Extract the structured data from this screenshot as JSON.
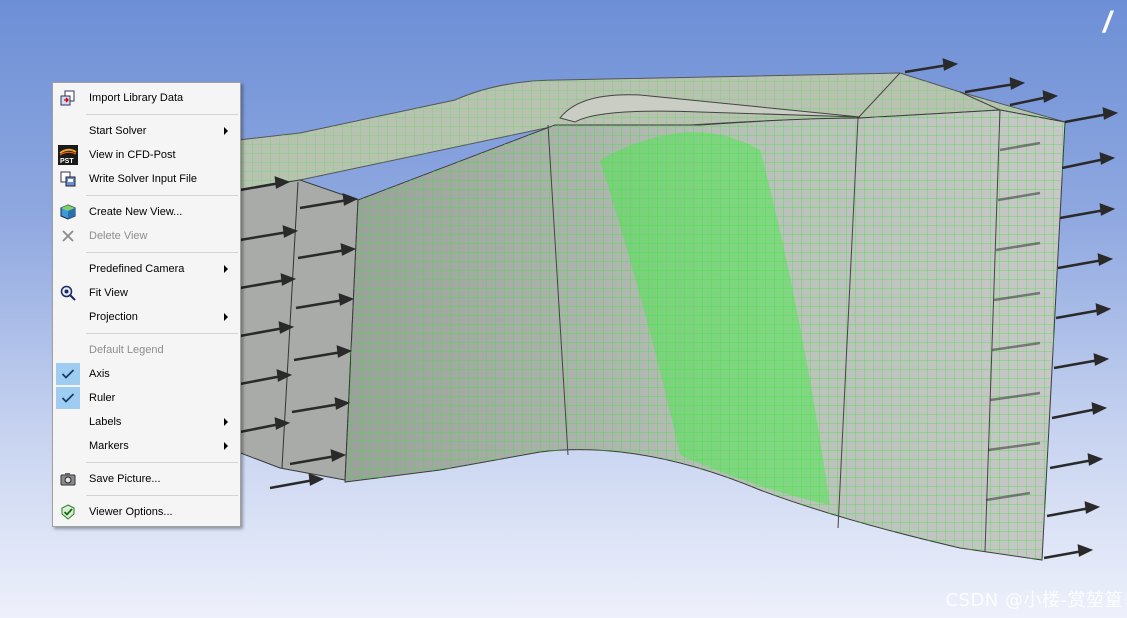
{
  "watermark": "CSDN @小楼-赏堃篁",
  "logo": "/",
  "menu": {
    "import_library_data": "Import Library Data",
    "start_solver": "Start Solver",
    "view_in_cfd_post": "View in CFD-Post",
    "write_solver_input_file": "Write Solver Input File",
    "create_new_view": "Create New View...",
    "delete_view": "Delete View",
    "predefined_camera": "Predefined Camera",
    "fit_view": "Fit View",
    "projection": "Projection",
    "default_legend": "Default Legend",
    "axis": "Axis",
    "ruler": "Ruler",
    "labels": "Labels",
    "markers": "Markers",
    "save_picture": "Save Picture...",
    "viewer_options": "Viewer Options..."
  },
  "icons": {
    "pst_badge": "PST"
  },
  "colors": {
    "mesh": "#33ee33",
    "body": "#bcbcbc",
    "arrow": "#2a2a2a",
    "check_highlight": "#9fcdf2"
  }
}
